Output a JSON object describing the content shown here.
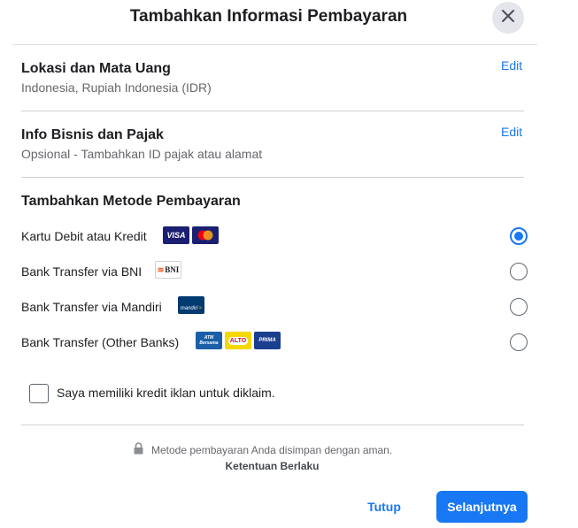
{
  "dialog": {
    "title": "Tambahkan Informasi Pembayaran"
  },
  "location": {
    "title": "Lokasi dan Mata Uang",
    "subtitle": "Indonesia, Rupiah Indonesia (IDR)",
    "edit_label": "Edit"
  },
  "business": {
    "title": "Info Bisnis dan Pajak",
    "subtitle": "Opsional - Tambahkan ID pajak atau alamat",
    "edit_label": "Edit"
  },
  "payment_methods": {
    "title": "Tambahkan Metode Pembayaran",
    "items": [
      {
        "label": "Kartu Debit atau Kredit",
        "selected": true,
        "logos": [
          "VISA",
          "mastercard-icon"
        ]
      },
      {
        "label": "Bank Transfer via BNI",
        "selected": false,
        "logos": [
          "BNI"
        ]
      },
      {
        "label": "Bank Transfer via Mandiri",
        "selected": false,
        "logos": [
          "mandiri"
        ]
      },
      {
        "label": "Bank Transfer (Other Banks)",
        "selected": false,
        "logos": [
          "ATM Bersama",
          "ALTO",
          "PRIMA"
        ]
      }
    ]
  },
  "ad_credit": {
    "label": "Saya memiliki kredit iklan untuk diklaim.",
    "checked": false
  },
  "footer": {
    "secure_note": "Metode pembayaran Anda disimpan dengan aman.",
    "terms": "Ketentuan Berlaku",
    "cancel_label": "Tutup",
    "next_label": "Selanjutnya"
  },
  "colors": {
    "accent": "#1877f2",
    "visa": "#1a1f71",
    "mastercard_red": "#eb001b",
    "mastercard_yellow": "#f79e1b",
    "alto_yellow": "#f5d800"
  }
}
